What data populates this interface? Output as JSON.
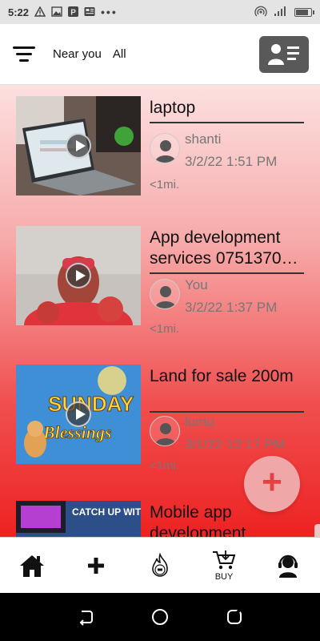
{
  "status_bar": {
    "time": "5:22",
    "notification_icons": [
      "warning-icon",
      "image-icon",
      "parking-icon",
      "news-icon"
    ],
    "more_indicator": "•••",
    "right_icons": [
      "hotspot-icon",
      "signal-icon",
      "battery-icon"
    ],
    "battery_level": 0.9
  },
  "header": {
    "filter_icon": "filter-icon",
    "near_you_label": "Near you",
    "all_label": "All",
    "profile_icon": "contact-card-icon"
  },
  "listings": [
    {
      "title": "laptop",
      "user": "shanti",
      "time": "3/2/22 1:51 PM",
      "distance": "<1mi.",
      "thumbnail": "laptop-photo"
    },
    {
      "title": "App development services 0751370…",
      "user": "You",
      "time": "3/2/22 1:37 PM",
      "distance": "<1mi.",
      "thumbnail": "person-photo"
    },
    {
      "title": "Land for sale 200m",
      "user": "lumu",
      "time": "3/1/22 12:17 PM",
      "distance": "<1mi.",
      "thumbnail": "sunday-blessings-photo"
    },
    {
      "title": "Mobile app development",
      "thumbnail": "screen-photo",
      "thumbnail_text": "CATCH UP WITH ALL"
    }
  ],
  "thumbnail_texts": {
    "sunday": "SUNDAY",
    "blessings": "Blessings"
  },
  "fab": {
    "icon": "plus-icon",
    "label": "+"
  },
  "bottom_nav": {
    "home_icon": "home-icon",
    "add_icon": "plus-icon",
    "fire_icon": "hot-deals-icon",
    "buy_icon": "cart-icon",
    "buy_label": "BUY",
    "support_icon": "support-agent-icon"
  },
  "system_nav": [
    "back-icon",
    "home-circle-icon",
    "recents-icon"
  ],
  "colors": {
    "accent_red": "#e84040",
    "header_bg": "#ffffff",
    "profile_btn": "#595959"
  }
}
